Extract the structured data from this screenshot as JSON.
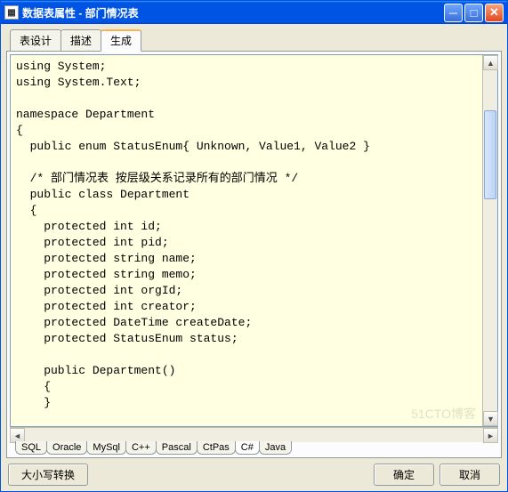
{
  "window": {
    "title": "数据表属性 - 部门情况表"
  },
  "topTabs": {
    "t0": "表设计",
    "t1": "描述",
    "t2": "生成"
  },
  "code": "using System;\nusing System.Text;\n\nnamespace Department\n{\n  public enum StatusEnum{ Unknown, Value1, Value2 }\n\n  /* 部门情况表 按层级关系记录所有的部门情况 */\n  public class Department\n  {\n    protected int id;\n    protected int pid;\n    protected string name;\n    protected string memo;\n    protected int orgId;\n    protected int creator;\n    protected DateTime createDate;\n    protected StatusEnum status;\n\n    public Department()\n    {\n    }",
  "bottomTabs": {
    "b0": "SQL",
    "b1": "Oracle",
    "b2": "MySql",
    "b3": "C++",
    "b4": "Pascal",
    "b5": "CtPas",
    "b6": "C#",
    "b7": "Java"
  },
  "buttons": {
    "caseToggle": "大小写转换",
    "ok": "确定",
    "cancel": "取消"
  },
  "watermark": "51CTO博客"
}
